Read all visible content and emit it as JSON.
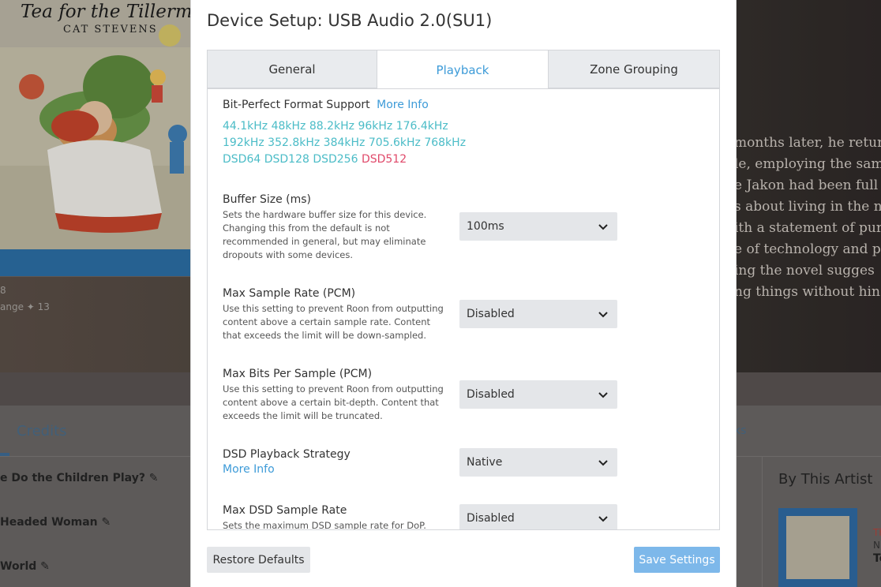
{
  "background": {
    "album_title": "Tea for the Tillerman",
    "album_artist": "CAT STEVENS",
    "partial_number": "8",
    "partial_change": "ange ✦ 13",
    "prose_lines": [
      "months later, he retur",
      "le, employing the sam",
      "e Jakon had been full",
      "s about living in the n",
      "ith a statement of pur",
      "e of technology and pr",
      "ing the novel sugges",
      "ng things without hin"
    ],
    "credits_tab": "Credits",
    "links_tab": "ks",
    "tracks": [
      "e Do the Children Play? ✎",
      "Headed Woman ✎",
      "World ✎"
    ],
    "by_this_artist": "By This Artist",
    "side_text": [
      "Th",
      "N",
      "Te"
    ]
  },
  "modal": {
    "title": "Device Setup: USB Audio 2.0(SU1)",
    "tabs": [
      {
        "label": "General",
        "active": false
      },
      {
        "label": "Playback",
        "active": true
      },
      {
        "label": "Zone Grouping",
        "active": false
      }
    ],
    "bitperfect": {
      "label": "Bit-Perfect Format Support",
      "more_info": "More Info",
      "rates_line1": "44.1kHz 48kHz 88.2kHz 96kHz 176.4kHz",
      "rates_line2": "192kHz 352.8kHz 384kHz 705.6kHz 768kHz",
      "rates_line3": "DSD64 DSD128 DSD256",
      "rates_unsupported": "DSD512",
      "supported_color": "#4bbcc7",
      "unsupported_color": "#e0496a"
    },
    "settings": {
      "buffer": {
        "label": "Buffer Size (ms)",
        "desc": "Sets the hardware buffer size for this device. Changing this from the default is not recommended in general, but may eliminate dropouts with some devices.",
        "value": "100ms"
      },
      "max_sample_rate": {
        "label": "Max Sample Rate (PCM)",
        "desc": "Use this setting to prevent Roon from outputting content above a certain sample rate. Content that exceeds the limit will be down-sampled.",
        "value": "Disabled"
      },
      "max_bits": {
        "label": "Max Bits Per Sample (PCM)",
        "desc": "Use this setting to prevent Roon from outputting content above a certain bit-depth. Content that exceeds the limit will be truncated.",
        "value": "Disabled"
      },
      "dsd_strategy": {
        "label": "DSD Playback Strategy",
        "link": "More Info",
        "value": "Native"
      },
      "max_dsd_rate": {
        "label": "Max DSD Sample Rate",
        "desc": "Sets the maximum DSD sample rate for DoP.",
        "value": "Disabled"
      }
    },
    "buttons": {
      "restore": "Restore Defaults",
      "save": "Save Settings"
    }
  }
}
